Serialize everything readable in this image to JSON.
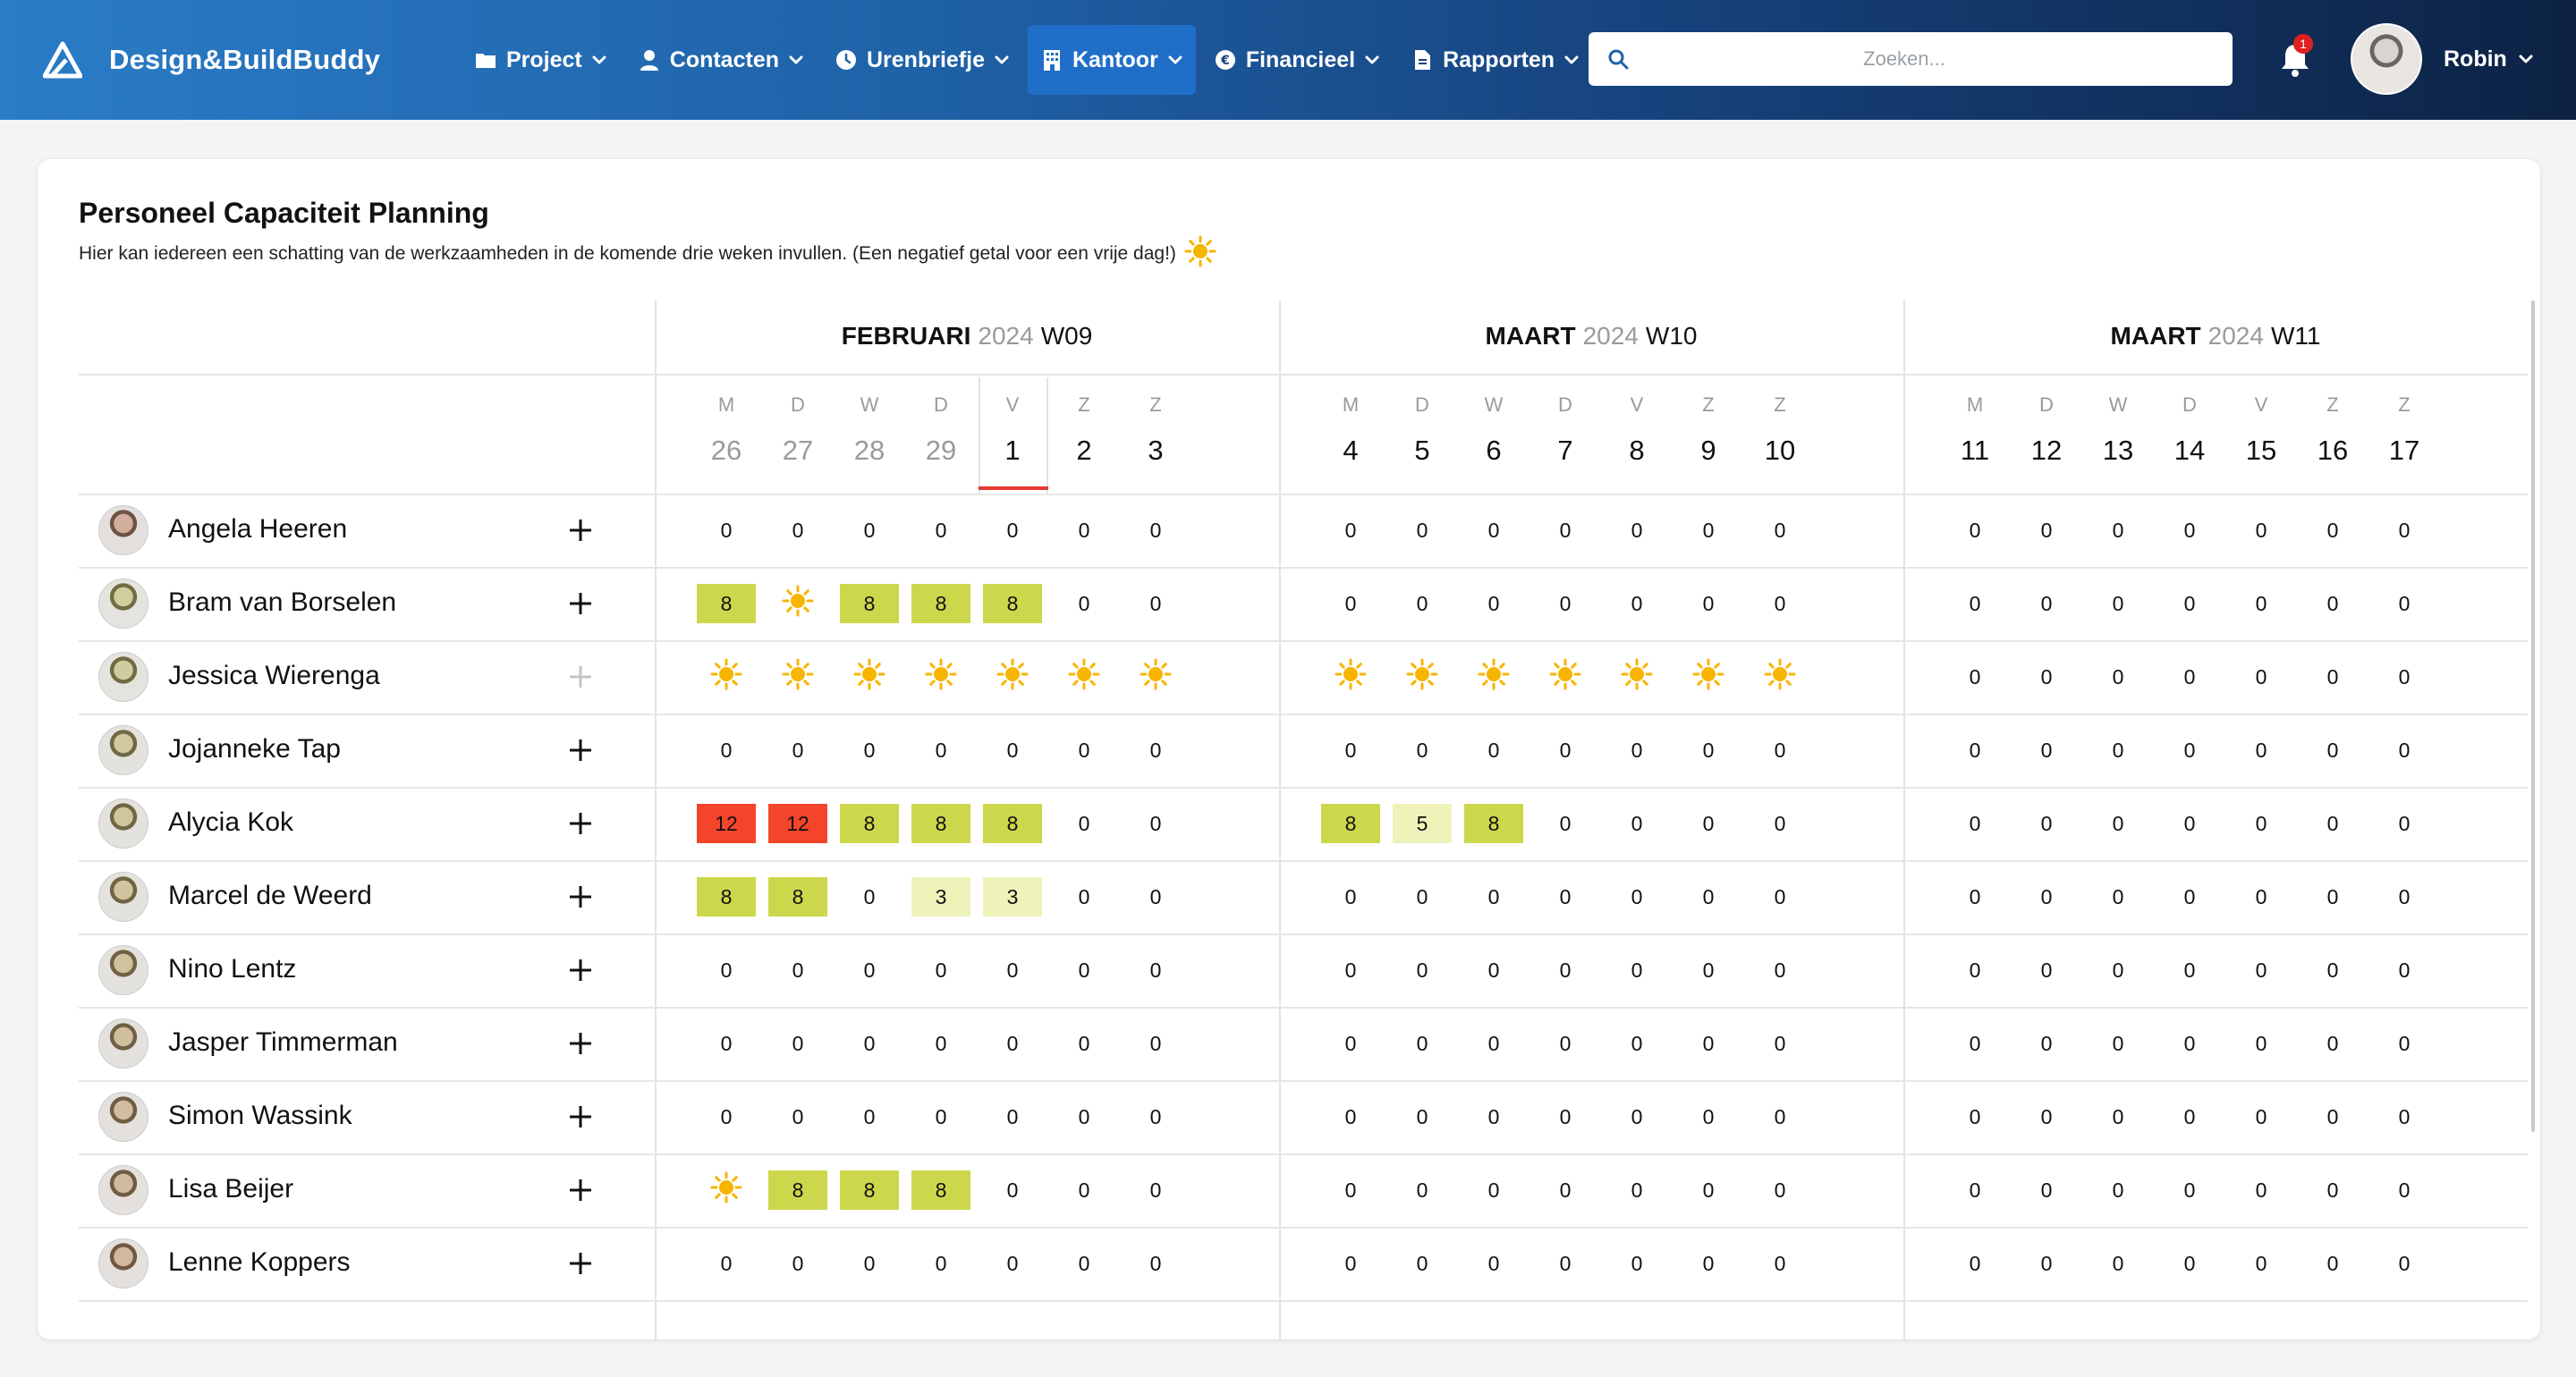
{
  "app": {
    "name": "Design&BuildBuddy"
  },
  "nav": [
    {
      "label": "Project",
      "icon": "folder-icon",
      "active": false
    },
    {
      "label": "Contacten",
      "icon": "user-icon",
      "active": false
    },
    {
      "label": "Urenbriefje",
      "icon": "clock-icon",
      "active": false
    },
    {
      "label": "Kantoor",
      "icon": "building-icon",
      "active": true
    },
    {
      "label": "Financieel",
      "icon": "euro-icon",
      "active": false
    },
    {
      "label": "Rapporten",
      "icon": "document-icon",
      "active": false
    }
  ],
  "search": {
    "placeholder": "Zoeken..."
  },
  "notifications": {
    "count": "1"
  },
  "user": {
    "name": "Robin"
  },
  "page": {
    "title": "Personeel Capaciteit Planning",
    "subtitle": "Hier kan iedereen een schatting van de werkzaamheden in de komende drie weken invullen. (Een negatief getal voor een vrije dag!)"
  },
  "weeks": [
    {
      "month": "FEBRUARI",
      "year": "2024",
      "week": "W09",
      "days": [
        {
          "dow": "M",
          "num": "26",
          "past": true
        },
        {
          "dow": "D",
          "num": "27",
          "past": true
        },
        {
          "dow": "W",
          "num": "28",
          "past": true
        },
        {
          "dow": "D",
          "num": "29",
          "past": true
        },
        {
          "dow": "V",
          "num": "1",
          "past": false,
          "today": true
        },
        {
          "dow": "Z",
          "num": "2",
          "past": false
        },
        {
          "dow": "Z",
          "num": "3",
          "past": false
        }
      ]
    },
    {
      "month": "MAART",
      "year": "2024",
      "week": "W10",
      "days": [
        {
          "dow": "M",
          "num": "4"
        },
        {
          "dow": "D",
          "num": "5"
        },
        {
          "dow": "W",
          "num": "6"
        },
        {
          "dow": "D",
          "num": "7"
        },
        {
          "dow": "V",
          "num": "8"
        },
        {
          "dow": "Z",
          "num": "9"
        },
        {
          "dow": "Z",
          "num": "10"
        }
      ]
    },
    {
      "month": "MAART",
      "year": "2024",
      "week": "W11",
      "days": [
        {
          "dow": "M",
          "num": "11"
        },
        {
          "dow": "D",
          "num": "12"
        },
        {
          "dow": "W",
          "num": "13"
        },
        {
          "dow": "D",
          "num": "14"
        },
        {
          "dow": "V",
          "num": "15"
        },
        {
          "dow": "Z",
          "num": "16"
        },
        {
          "dow": "Z",
          "num": "17"
        }
      ]
    }
  ],
  "colors": {
    "high": "#ccd74c",
    "low": "#eff2b9",
    "over": "#f4452b",
    "sun": "#f7b500",
    "today": "#e53935"
  },
  "people": [
    {
      "name": "Angela Heeren",
      "plus_disabled": false,
      "values": [
        "0",
        "0",
        "0",
        "0",
        "0",
        "0",
        "0",
        "0",
        "0",
        "0",
        "0",
        "0",
        "0",
        "0",
        "0",
        "0",
        "0",
        "0",
        "0",
        "0",
        "0"
      ]
    },
    {
      "name": "Bram van Borselen",
      "plus_disabled": false,
      "values": [
        "8",
        "sun",
        "8",
        "8",
        "8",
        "0",
        "0",
        "0",
        "0",
        "0",
        "0",
        "0",
        "0",
        "0",
        "0",
        "0",
        "0",
        "0",
        "0",
        "0",
        "0"
      ]
    },
    {
      "name": "Jessica Wierenga",
      "plus_disabled": true,
      "values": [
        "sun",
        "sun",
        "sun",
        "sun",
        "sun",
        "sun",
        "sun",
        "sun",
        "sun",
        "sun",
        "sun",
        "sun",
        "sun",
        "sun",
        "0",
        "0",
        "0",
        "0",
        "0",
        "0",
        "0"
      ]
    },
    {
      "name": "Jojanneke Tap",
      "plus_disabled": false,
      "values": [
        "0",
        "0",
        "0",
        "0",
        "0",
        "0",
        "0",
        "0",
        "0",
        "0",
        "0",
        "0",
        "0",
        "0",
        "0",
        "0",
        "0",
        "0",
        "0",
        "0",
        "0"
      ]
    },
    {
      "name": "Alycia Kok",
      "plus_disabled": false,
      "values": [
        "12",
        "12",
        "8",
        "8",
        "8",
        "0",
        "0",
        "8",
        "5",
        "8",
        "0",
        "0",
        "0",
        "0",
        "0",
        "0",
        "0",
        "0",
        "0",
        "0",
        "0"
      ]
    },
    {
      "name": "Marcel de Weerd",
      "plus_disabled": false,
      "values": [
        "8",
        "8",
        "0",
        "3",
        "3",
        "0",
        "0",
        "0",
        "0",
        "0",
        "0",
        "0",
        "0",
        "0",
        "0",
        "0",
        "0",
        "0",
        "0",
        "0",
        "0"
      ]
    },
    {
      "name": "Nino Lentz",
      "plus_disabled": false,
      "values": [
        "0",
        "0",
        "0",
        "0",
        "0",
        "0",
        "0",
        "0",
        "0",
        "0",
        "0",
        "0",
        "0",
        "0",
        "0",
        "0",
        "0",
        "0",
        "0",
        "0",
        "0"
      ]
    },
    {
      "name": "Jasper Timmerman",
      "plus_disabled": false,
      "values": [
        "0",
        "0",
        "0",
        "0",
        "0",
        "0",
        "0",
        "0",
        "0",
        "0",
        "0",
        "0",
        "0",
        "0",
        "0",
        "0",
        "0",
        "0",
        "0",
        "0",
        "0"
      ]
    },
    {
      "name": "Simon Wassink",
      "plus_disabled": false,
      "values": [
        "0",
        "0",
        "0",
        "0",
        "0",
        "0",
        "0",
        "0",
        "0",
        "0",
        "0",
        "0",
        "0",
        "0",
        "0",
        "0",
        "0",
        "0",
        "0",
        "0",
        "0"
      ]
    },
    {
      "name": "Lisa Beijer",
      "plus_disabled": false,
      "values": [
        "sun",
        "8",
        "8",
        "8",
        "0",
        "0",
        "0",
        "0",
        "0",
        "0",
        "0",
        "0",
        "0",
        "0",
        "0",
        "0",
        "0",
        "0",
        "0",
        "0",
        "0"
      ]
    },
    {
      "name": "Lenne Koppers",
      "plus_disabled": false,
      "values": [
        "0",
        "0",
        "0",
        "0",
        "0",
        "0",
        "0",
        "0",
        "0",
        "0",
        "0",
        "0",
        "0",
        "0",
        "0",
        "0",
        "0",
        "0",
        "0",
        "0",
        "0"
      ]
    }
  ]
}
